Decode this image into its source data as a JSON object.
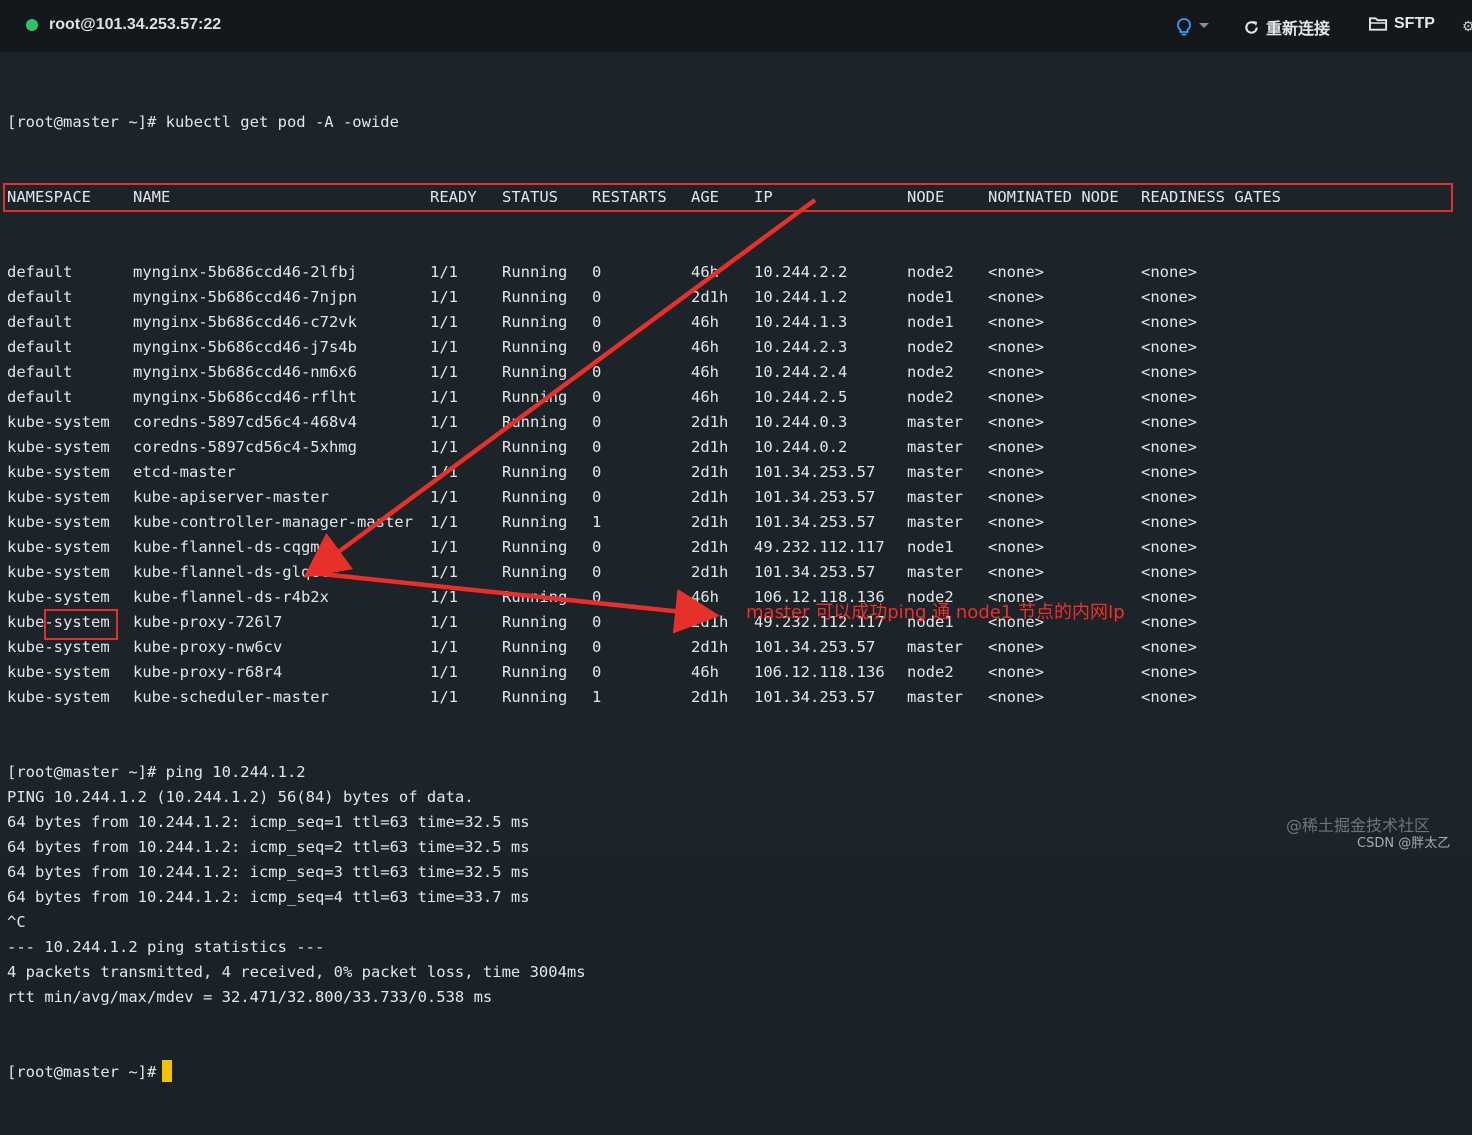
{
  "titlebar": {
    "host": "root@101.34.253.57:22",
    "status_color": "#2fc26b",
    "reconnect_label": "重新连接",
    "sftp_label": "SFTP",
    "icons": [
      "lightbulb-icon",
      "refresh-icon",
      "folder-icon"
    ]
  },
  "terminal": {
    "command_line": "[root@master ~]# kubectl get pod -A -owide",
    "headers": [
      "NAMESPACE",
      "NAME",
      "READY",
      "STATUS",
      "RESTARTS",
      "AGE",
      "IP",
      "NODE",
      "NOMINATED NODE",
      "READINESS GATES"
    ],
    "rows": [
      [
        "default",
        "mynginx-5b686ccd46-2lfbj",
        "1/1",
        "Running",
        "0",
        "46h",
        "10.244.2.2",
        "node2",
        "<none>",
        "<none>"
      ],
      [
        "default",
        "mynginx-5b686ccd46-7njpn",
        "1/1",
        "Running",
        "0",
        "2d1h",
        "10.244.1.2",
        "node1",
        "<none>",
        "<none>"
      ],
      [
        "default",
        "mynginx-5b686ccd46-c72vk",
        "1/1",
        "Running",
        "0",
        "46h",
        "10.244.1.3",
        "node1",
        "<none>",
        "<none>"
      ],
      [
        "default",
        "mynginx-5b686ccd46-j7s4b",
        "1/1",
        "Running",
        "0",
        "46h",
        "10.244.2.3",
        "node2",
        "<none>",
        "<none>"
      ],
      [
        "default",
        "mynginx-5b686ccd46-nm6x6",
        "1/1",
        "Running",
        "0",
        "46h",
        "10.244.2.4",
        "node2",
        "<none>",
        "<none>"
      ],
      [
        "default",
        "mynginx-5b686ccd46-rflht",
        "1/1",
        "Running",
        "0",
        "46h",
        "10.244.2.5",
        "node2",
        "<none>",
        "<none>"
      ],
      [
        "kube-system",
        "coredns-5897cd56c4-468v4",
        "1/1",
        "Running",
        "0",
        "2d1h",
        "10.244.0.3",
        "master",
        "<none>",
        "<none>"
      ],
      [
        "kube-system",
        "coredns-5897cd56c4-5xhmg",
        "1/1",
        "Running",
        "0",
        "2d1h",
        "10.244.0.2",
        "master",
        "<none>",
        "<none>"
      ],
      [
        "kube-system",
        "etcd-master",
        "1/1",
        "Running",
        "0",
        "2d1h",
        "101.34.253.57",
        "master",
        "<none>",
        "<none>"
      ],
      [
        "kube-system",
        "kube-apiserver-master",
        "1/1",
        "Running",
        "0",
        "2d1h",
        "101.34.253.57",
        "master",
        "<none>",
        "<none>"
      ],
      [
        "kube-system",
        "kube-controller-manager-master",
        "1/1",
        "Running",
        "1",
        "2d1h",
        "101.34.253.57",
        "master",
        "<none>",
        "<none>"
      ],
      [
        "kube-system",
        "kube-flannel-ds-cqgmn",
        "1/1",
        "Running",
        "0",
        "2d1h",
        "49.232.112.117",
        "node1",
        "<none>",
        "<none>"
      ],
      [
        "kube-system",
        "kube-flannel-ds-glqct",
        "1/1",
        "Running",
        "0",
        "2d1h",
        "101.34.253.57",
        "master",
        "<none>",
        "<none>"
      ],
      [
        "kube-system",
        "kube-flannel-ds-r4b2x",
        "1/1",
        "Running",
        "0",
        "46h",
        "106.12.118.136",
        "node2",
        "<none>",
        "<none>"
      ],
      [
        "kube-system",
        "kube-proxy-726l7",
        "1/1",
        "Running",
        "0",
        "2d1h",
        "49.232.112.117",
        "node1",
        "<none>",
        "<none>"
      ],
      [
        "kube-system",
        "kube-proxy-nw6cv",
        "1/1",
        "Running",
        "0",
        "2d1h",
        "101.34.253.57",
        "master",
        "<none>",
        "<none>"
      ],
      [
        "kube-system",
        "kube-proxy-r68r4",
        "1/1",
        "Running",
        "0",
        "46h",
        "106.12.118.136",
        "node2",
        "<none>",
        "<none>"
      ],
      [
        "kube-system",
        "kube-scheduler-master",
        "1/1",
        "Running",
        "1",
        "2d1h",
        "101.34.253.57",
        "master",
        "<none>",
        "<none>"
      ]
    ],
    "ping_output": [
      "[root@master ~]# ping 10.244.1.2",
      "PING 10.244.1.2 (10.244.1.2) 56(84) bytes of data.",
      "64 bytes from 10.244.1.2: icmp_seq=1 ttl=63 time=32.5 ms",
      "64 bytes from 10.244.1.2: icmp_seq=2 ttl=63 time=32.5 ms",
      "64 bytes from 10.244.1.2: icmp_seq=3 ttl=63 time=32.5 ms",
      "64 bytes from 10.244.1.2: icmp_seq=4 ttl=63 time=33.7 ms",
      "^C",
      "--- 10.244.1.2 ping statistics ---",
      "4 packets transmitted, 4 received, 0% packet loss, time 3004ms",
      "rtt min/avg/max/mdev = 32.471/32.800/33.733/0.538 ms"
    ],
    "final_prompt": "[root@master ~]#",
    "cursor_color": "#f2c200"
  },
  "annotation": {
    "text": "master 可以成功ping 通 node1 节点的内网Ip",
    "color": "#f0302a"
  },
  "watermark": {
    "line1": "@稀土掘金技术社区",
    "line2": "CSDN @胖太乙"
  }
}
